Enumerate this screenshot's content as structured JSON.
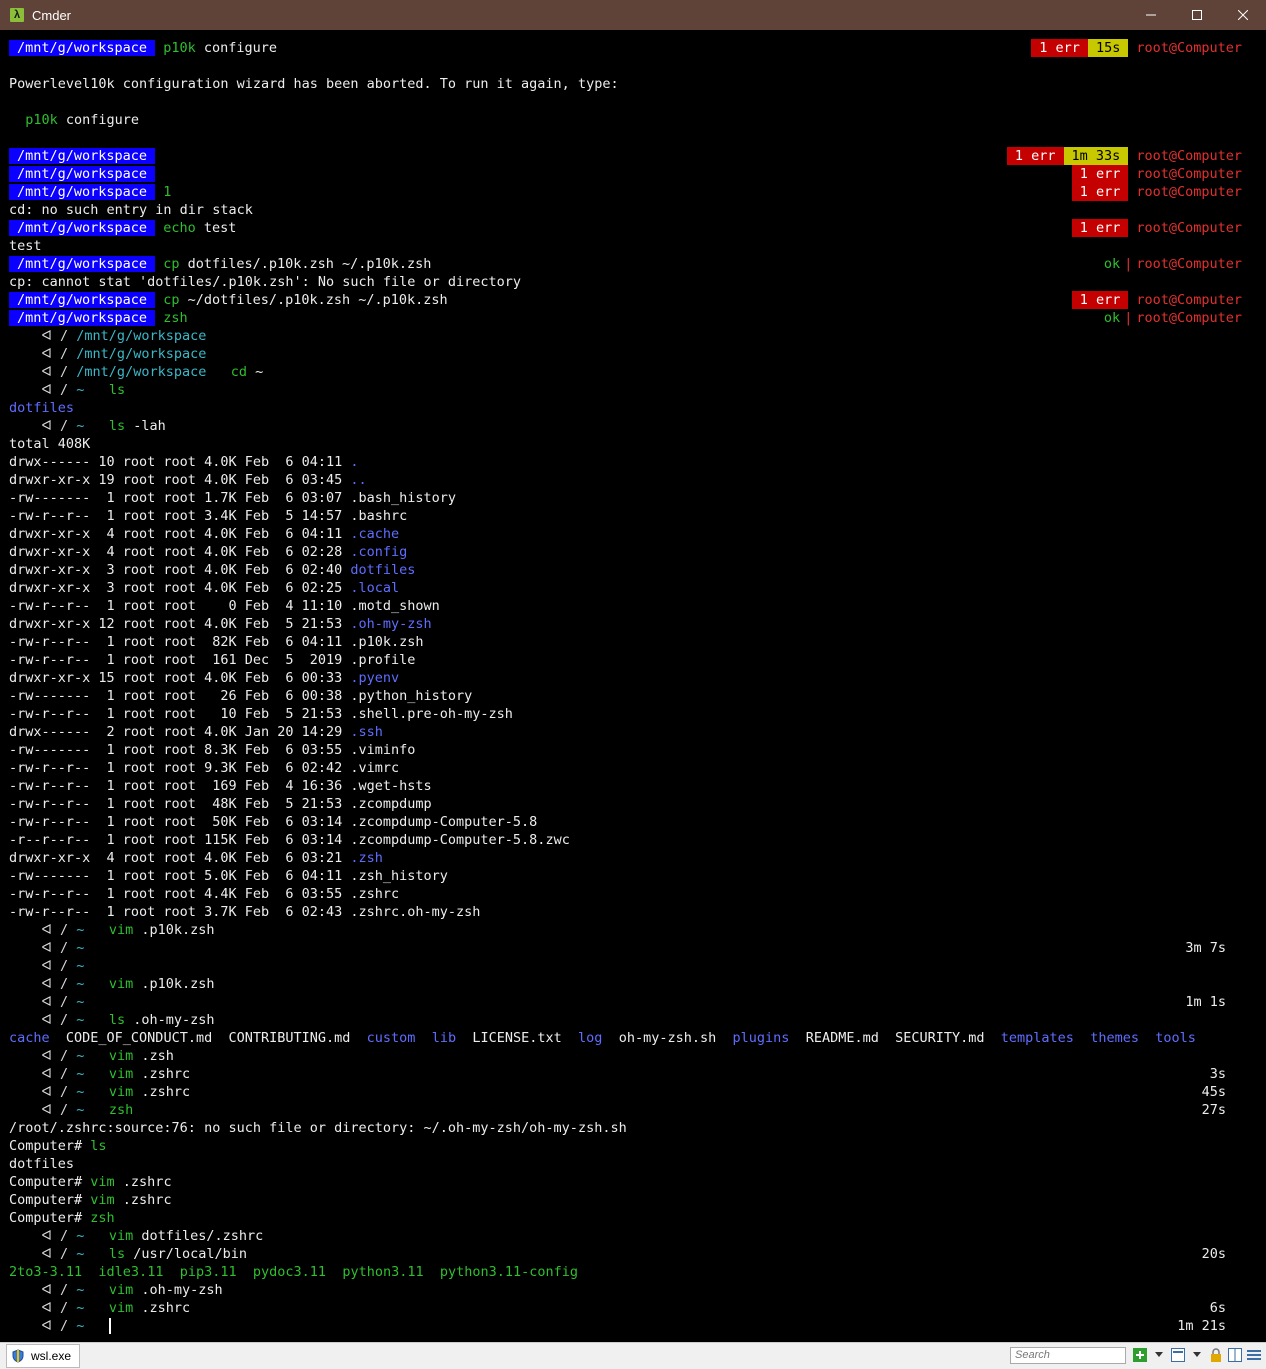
{
  "window": {
    "title": "Cmder",
    "app_icon": "λ",
    "accent": "#5f4338"
  },
  "colors": {
    "pwd_bg": "#0b00ff",
    "err_bg": "#c50000",
    "time_bg": "#c8c800",
    "user": "#e23030",
    "cmd": "#2fbf2f",
    "dir": "#5f6dff",
    "path": "#3bb8c8"
  },
  "p10k": {
    "l1": {
      "pwd": "/mnt/g/workspace",
      "cmd": "p10k",
      "arg": " configure",
      "err": "1 err",
      "time": "15s",
      "user": "root@Computer"
    },
    "msg": "Powerlevel10k configuration wizard has been aborted. To run it again, type:",
    "hint_cmd": "p10k",
    "hint_arg": " configure",
    "l2": {
      "pwd": "/mnt/g/workspace",
      "err": "1 err",
      "time": "1m 33s",
      "user": "root@Computer"
    },
    "l3": {
      "pwd": "/mnt/g/workspace",
      "err": "1 err",
      "user": "root@Computer"
    },
    "l4": {
      "pwd": "/mnt/g/workspace",
      "cmd": "1",
      "err": "1 err",
      "user": "root@Computer"
    },
    "out1": "cd: no such entry in dir stack",
    "l5": {
      "pwd": "/mnt/g/workspace",
      "cmd": "echo",
      "arg": " test",
      "err": "1 err",
      "user": "root@Computer"
    },
    "out2": "test",
    "l6": {
      "pwd": "/mnt/g/workspace",
      "cmd": "cp",
      "arg": " dotfiles/.p10k.zsh ~/.p10k.zsh",
      "ok": "ok",
      "bar": "|",
      "user": "root@Computer"
    },
    "out3": "cp: cannot stat 'dotfiles/.p10k.zsh': No such file or directory",
    "l7": {
      "pwd": "/mnt/g/workspace",
      "cmd": "cp",
      "arg": " ~/dotfiles/.p10k.zsh ~/.p10k.zsh",
      "err": "1 err",
      "user": "root@Computer"
    },
    "l8": {
      "pwd": "/mnt/g/workspace",
      "cmd": "zsh",
      "ok": "ok",
      "bar": "|",
      "user": "root@Computer"
    }
  },
  "prompt": {
    "arrow": "    ᐊ",
    "sep": " / ",
    "tilde": "~"
  },
  "zsh": {
    "p1": "/mnt/g/workspace",
    "p2": "/mnt/g/workspace",
    "p3": "/mnt/g/workspace",
    "p3_cmd": "cd",
    "p3_arg": " ~",
    "c4": "ls",
    "o4": "dotfiles",
    "c5": "ls",
    "c5_arg": " -lah",
    "total": "total 408K"
  },
  "listing": [
    {
      "perm": "drwx------ 10 root root 4.0K Feb  6 04:11 ",
      "name": ".",
      "dir": true
    },
    {
      "perm": "drwxr-xr-x 19 root root 4.0K Feb  6 03:45 ",
      "name": "..",
      "dir": true
    },
    {
      "perm": "-rw-------  1 root root 1.7K Feb  6 03:07 ",
      "name": ".bash_history",
      "dir": false
    },
    {
      "perm": "-rw-r--r--  1 root root 3.4K Feb  5 14:57 ",
      "name": ".bashrc",
      "dir": false
    },
    {
      "perm": "drwxr-xr-x  4 root root 4.0K Feb  6 04:11 ",
      "name": ".cache",
      "dir": true
    },
    {
      "perm": "drwxr-xr-x  4 root root 4.0K Feb  6 02:28 ",
      "name": ".config",
      "dir": true
    },
    {
      "perm": "drwxr-xr-x  3 root root 4.0K Feb  6 02:40 ",
      "name": "dotfiles",
      "dir": true
    },
    {
      "perm": "drwxr-xr-x  3 root root 4.0K Feb  6 02:25 ",
      "name": ".local",
      "dir": true
    },
    {
      "perm": "-rw-r--r--  1 root root    0 Feb  4 11:10 ",
      "name": ".motd_shown",
      "dir": false
    },
    {
      "perm": "drwxr-xr-x 12 root root 4.0K Feb  5 21:53 ",
      "name": ".oh-my-zsh",
      "dir": true
    },
    {
      "perm": "-rw-r--r--  1 root root  82K Feb  6 04:11 ",
      "name": ".p10k.zsh",
      "dir": false
    },
    {
      "perm": "-rw-r--r--  1 root root  161 Dec  5  2019 ",
      "name": ".profile",
      "dir": false
    },
    {
      "perm": "drwxr-xr-x 15 root root 4.0K Feb  6 00:33 ",
      "name": ".pyenv",
      "dir": true
    },
    {
      "perm": "-rw-------  1 root root   26 Feb  6 00:38 ",
      "name": ".python_history",
      "dir": false
    },
    {
      "perm": "-rw-r--r--  1 root root   10 Feb  5 21:53 ",
      "name": ".shell.pre-oh-my-zsh",
      "dir": false
    },
    {
      "perm": "drwx------  2 root root 4.0K Jan 20 14:29 ",
      "name": ".ssh",
      "dir": true
    },
    {
      "perm": "-rw-------  1 root root 8.3K Feb  6 03:55 ",
      "name": ".viminfo",
      "dir": false
    },
    {
      "perm": "-rw-r--r--  1 root root 9.3K Feb  6 02:42 ",
      "name": ".vimrc",
      "dir": false
    },
    {
      "perm": "-rw-r--r--  1 root root  169 Feb  4 16:36 ",
      "name": ".wget-hsts",
      "dir": false
    },
    {
      "perm": "-rw-r--r--  1 root root  48K Feb  5 21:53 ",
      "name": ".zcompdump",
      "dir": false
    },
    {
      "perm": "-rw-r--r--  1 root root  50K Feb  6 03:14 ",
      "name": ".zcompdump-Computer-5.8",
      "dir": false
    },
    {
      "perm": "-r--r--r--  1 root root 115K Feb  6 03:14 ",
      "name": ".zcompdump-Computer-5.8.zwc",
      "dir": false
    },
    {
      "perm": "drwxr-xr-x  4 root root 4.0K Feb  6 03:21 ",
      "name": ".zsh",
      "dir": true
    },
    {
      "perm": "-rw-------  1 root root 5.0K Feb  6 04:11 ",
      "name": ".zsh_history",
      "dir": false
    },
    {
      "perm": "-rw-r--r--  1 root root 4.4K Feb  6 03:55 ",
      "name": ".zshrc",
      "dir": false
    },
    {
      "perm": "-rw-r--r--  1 root root 3.7K Feb  6 02:43 ",
      "name": ".zshrc.oh-my-zsh",
      "dir": false
    }
  ],
  "later": [
    {
      "cmd": "vim",
      "arg": " .p10k.zsh",
      "time": ""
    },
    {
      "cmd": "",
      "arg": "",
      "time": "3m 7s"
    },
    {
      "cmd": "",
      "arg": "",
      "time": ""
    },
    {
      "cmd": "vim",
      "arg": " .p10k.zsh",
      "time": ""
    },
    {
      "cmd": "",
      "arg": "",
      "time": "1m 1s"
    },
    {
      "cmd": "ls",
      "arg": " .oh-my-zsh",
      "time": ""
    }
  ],
  "omz_ls": [
    {
      "name": "cache",
      "dir": true
    },
    {
      "name": "CODE_OF_CONDUCT.md",
      "dir": false
    },
    {
      "name": "CONTRIBUTING.md",
      "dir": false
    },
    {
      "name": "custom",
      "dir": true
    },
    {
      "name": "lib",
      "dir": true
    },
    {
      "name": "LICENSE.txt",
      "dir": false
    },
    {
      "name": "log",
      "dir": true
    },
    {
      "name": "oh-my-zsh.sh",
      "dir": false
    },
    {
      "name": "plugins",
      "dir": true
    },
    {
      "name": "README.md",
      "dir": false
    },
    {
      "name": "SECURITY.md",
      "dir": false
    },
    {
      "name": "templates",
      "dir": true
    },
    {
      "name": "themes",
      "dir": true
    },
    {
      "name": "tools",
      "dir": true
    }
  ],
  "later2": [
    {
      "cmd": "vim",
      "arg": " .zsh",
      "time": ""
    },
    {
      "cmd": "vim",
      "arg": " .zshrc",
      "time": "3s"
    },
    {
      "cmd": "vim",
      "arg": " .zshrc",
      "time": "45s"
    },
    {
      "cmd": "zsh",
      "arg": "",
      "time": "27s"
    }
  ],
  "plain": {
    "err": "/root/.zshrc:source:76: no such file or directory: ~/.oh-my-zsh/oh-my-zsh.sh",
    "ps": "Computer# ",
    "c1": "ls",
    "o1": "dotfiles",
    "c2": "vim",
    "a2": " .zshrc",
    "c3": "vim",
    "a3": " .zshrc",
    "c4": "zsh"
  },
  "later3": [
    {
      "cmd": "vim",
      "arg": " dotfiles/.zshrc",
      "time": ""
    },
    {
      "cmd": "ls",
      "arg": " /usr/local/bin",
      "time": "20s"
    }
  ],
  "bin_ls": [
    "2to3-3.11",
    "idle3.11",
    "pip3.11",
    "pydoc3.11",
    "python3.11",
    "python3.11-config"
  ],
  "later4": [
    {
      "cmd": "vim",
      "arg": " .oh-my-zsh",
      "time": ""
    },
    {
      "cmd": "vim",
      "arg": " .zshrc",
      "time": "6s"
    },
    {
      "cmd": "",
      "arg": "",
      "time": "1m 21s"
    }
  ],
  "status": {
    "tab": "wsl.exe",
    "search_placeholder": "Search"
  }
}
